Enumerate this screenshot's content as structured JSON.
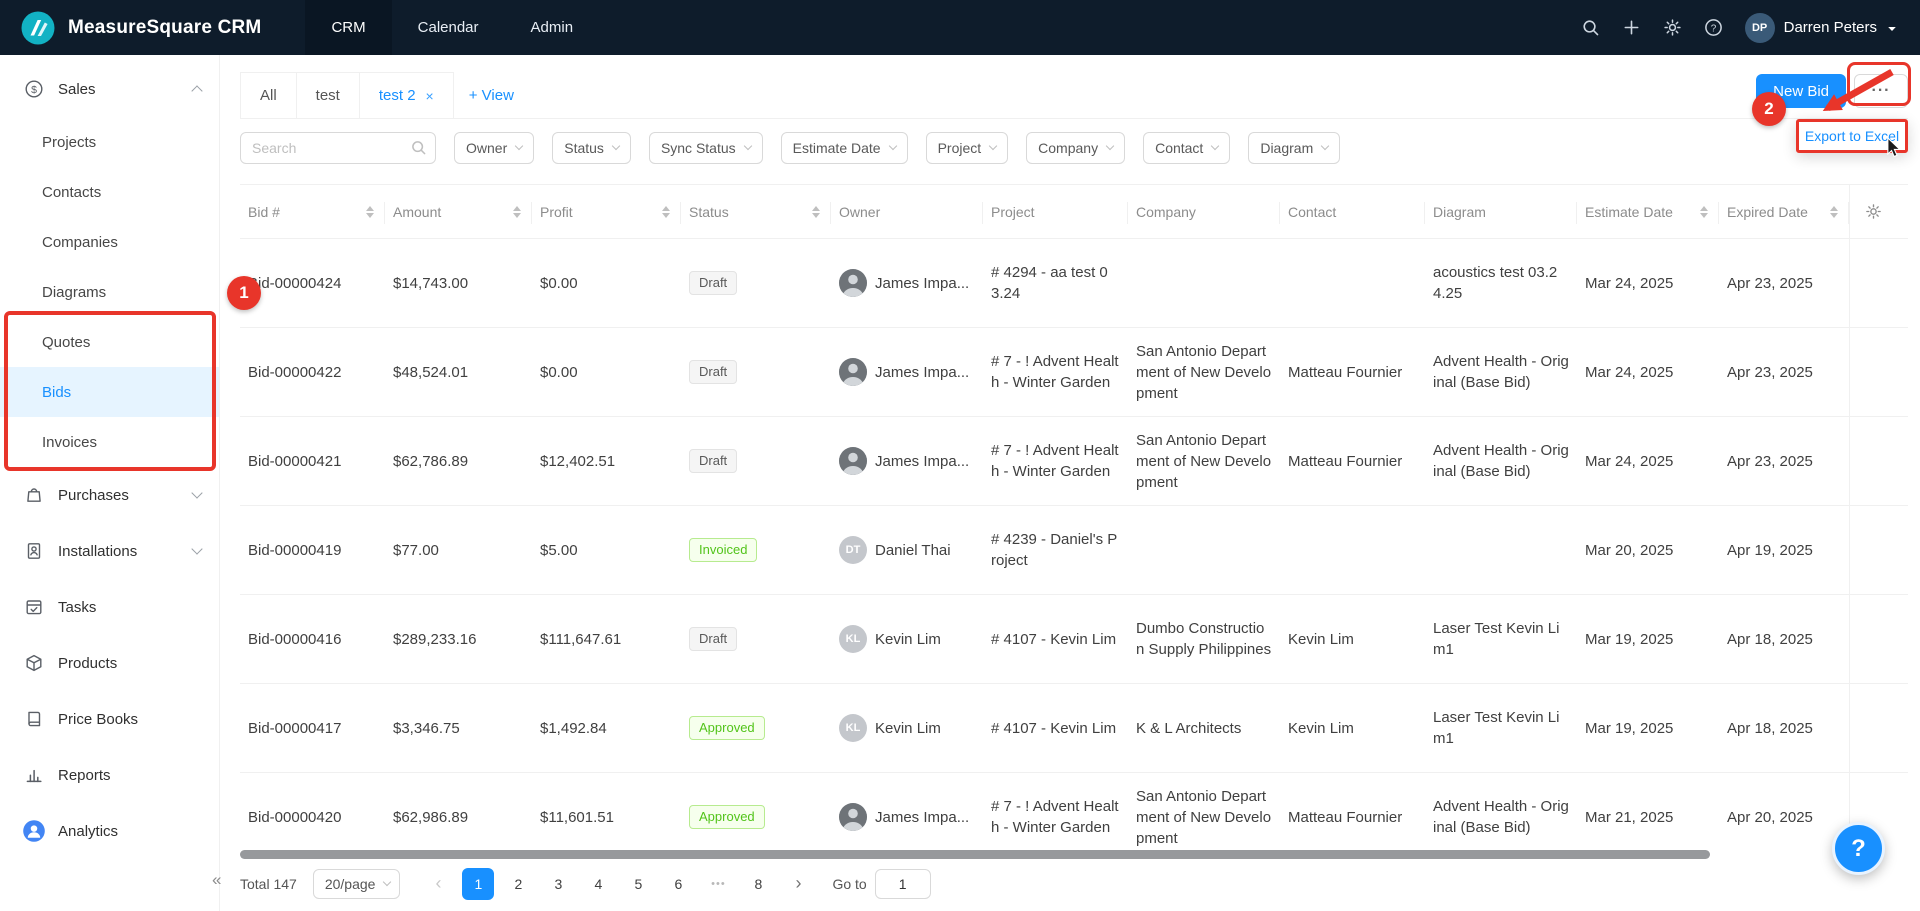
{
  "colors": {
    "accent": "#1890ff",
    "annotation_red": "#e8352a",
    "success_green": "#52c41a",
    "topbar_bg": "#0e1c2b"
  },
  "topbar": {
    "title": "MeasureSquare CRM",
    "nav": [
      {
        "label": "CRM",
        "active": true
      },
      {
        "label": "Calendar"
      },
      {
        "label": "Admin"
      }
    ],
    "user": {
      "name": "Darren Peters",
      "initials": "DP"
    }
  },
  "sidebar": {
    "items": [
      {
        "label": "Sales",
        "icon": "sales",
        "expanded": true,
        "children": [
          {
            "label": "Projects"
          },
          {
            "label": "Contacts"
          },
          {
            "label": "Companies"
          },
          {
            "label": "Diagrams"
          },
          {
            "label": "Quotes"
          },
          {
            "label": "Bids",
            "active": true
          },
          {
            "label": "Invoices"
          }
        ]
      },
      {
        "label": "Purchases",
        "icon": "purchases",
        "collapsible": true
      },
      {
        "label": "Installations",
        "icon": "installations",
        "collapsible": true
      },
      {
        "label": "Tasks",
        "icon": "tasks"
      },
      {
        "label": "Products",
        "icon": "products"
      },
      {
        "label": "Price Books",
        "icon": "price-books"
      },
      {
        "label": "Reports",
        "icon": "reports"
      },
      {
        "label": "Analytics",
        "icon": "analytics"
      }
    ],
    "collapse_icon": "«"
  },
  "tabs": {
    "items": [
      {
        "label": "All"
      },
      {
        "label": "test"
      },
      {
        "label": "test 2",
        "closable": true,
        "active": true
      }
    ],
    "close_icon": "×",
    "add_view_label": "+ View"
  },
  "toolbar": {
    "new_bid_label": "New Bid",
    "more_label": "···",
    "export_menu_item": "Export to Excel"
  },
  "filters": {
    "search_placeholder": "Search",
    "dropdowns": [
      {
        "label": "Owner"
      },
      {
        "label": "Status"
      },
      {
        "label": "Sync Status"
      },
      {
        "label": "Estimate Date"
      },
      {
        "label": "Project"
      },
      {
        "label": "Company"
      },
      {
        "label": "Contact"
      },
      {
        "label": "Diagram"
      }
    ]
  },
  "table": {
    "columns": [
      {
        "label": "Bid #",
        "sortable": true
      },
      {
        "label": "Amount",
        "sortable": true
      },
      {
        "label": "Profit",
        "sortable": true
      },
      {
        "label": "Status",
        "sortable": true
      },
      {
        "label": "Owner"
      },
      {
        "label": "Project"
      },
      {
        "label": "Company"
      },
      {
        "label": "Contact"
      },
      {
        "label": "Diagram"
      },
      {
        "label": "Estimate Date",
        "sortable": true
      },
      {
        "label": "Expired Date",
        "sortable": true
      }
    ],
    "rows": [
      {
        "bid": "Bid-00000424",
        "amount": "$14,743.00",
        "profit": "$0.00",
        "status": "Draft",
        "status_type": "default",
        "owner": "James Impa...",
        "project": "# 4294 - aa test 03.24",
        "company": "",
        "contact": "",
        "diagram": "acoustics test 03.24.25",
        "estimate_date": "Mar 24, 2025",
        "expired_date": "Apr 23, 2025"
      },
      {
        "bid": "Bid-00000422",
        "amount": "$48,524.01",
        "profit": "$0.00",
        "status": "Draft",
        "status_type": "default",
        "owner": "James Impa...",
        "project": "# 7 - ! Advent Health - Winter Garden",
        "company": "San Antonio Department of New Development",
        "contact": "Matteau Fournier",
        "diagram": "Advent Health - Original (Base Bid)",
        "estimate_date": "Mar 24, 2025",
        "expired_date": "Apr 23, 2025"
      },
      {
        "bid": "Bid-00000421",
        "amount": "$62,786.89",
        "profit": "$12,402.51",
        "status": "Draft",
        "status_type": "default",
        "owner": "James Impa...",
        "project": "# 7 - ! Advent Health - Winter Garden",
        "company": "San Antonio Department of New Development",
        "contact": "Matteau Fournier",
        "diagram": "Advent Health - Original (Base Bid)",
        "estimate_date": "Mar 24, 2025",
        "expired_date": "Apr 23, 2025"
      },
      {
        "bid": "Bid-00000419",
        "amount": "$77.00",
        "profit": "$5.00",
        "status": "Invoiced",
        "status_type": "success",
        "owner": "Daniel Thai",
        "owner_initials": "DT",
        "project": "# 4239 - Daniel's Project",
        "company": "",
        "contact": "",
        "diagram": "",
        "estimate_date": "Mar 20, 2025",
        "expired_date": "Apr 19, 2025"
      },
      {
        "bid": "Bid-00000416",
        "amount": "$289,233.16",
        "profit": "$111,647.61",
        "status": "Draft",
        "status_type": "default",
        "owner": "Kevin Lim",
        "owner_initials": "KL",
        "project": "# 4107 - Kevin Lim",
        "company": "Dumbo Construction Supply Philippines",
        "contact": "Kevin Lim",
        "diagram": "Laser Test Kevin Lim1",
        "estimate_date": "Mar 19, 2025",
        "expired_date": "Apr 18, 2025"
      },
      {
        "bid": "Bid-00000417",
        "amount": "$3,346.75",
        "profit": "$1,492.84",
        "status": "Approved",
        "status_type": "success",
        "owner": "Kevin Lim",
        "owner_initials": "KL",
        "project": "# 4107 - Kevin Lim",
        "company": "K & L Architects",
        "contact": "Kevin Lim",
        "diagram": "Laser Test Kevin Lim1",
        "estimate_date": "Mar 19, 2025",
        "expired_date": "Apr 18, 2025"
      },
      {
        "bid": "Bid-00000420",
        "amount": "$62,986.89",
        "profit": "$11,601.51",
        "status": "Approved",
        "status_type": "success",
        "owner": "James Impa...",
        "project": "# 7 - ! Advent Health - Winter Garden",
        "company": "San Antonio Department of New Development",
        "contact": "Matteau Fournier",
        "diagram": "Advent Health - Original (Base Bid)",
        "estimate_date": "Mar 21, 2025",
        "expired_date": "Apr 20, 2025"
      }
    ]
  },
  "pagination": {
    "total": "Total 147",
    "page_size": "20/page",
    "prev": "‹",
    "next": "›",
    "pages": [
      {
        "label": "1",
        "active": true
      },
      {
        "label": "2"
      },
      {
        "label": "3"
      },
      {
        "label": "4"
      },
      {
        "label": "5"
      },
      {
        "label": "6"
      },
      {
        "label": "•••",
        "type": "ellipsis"
      },
      {
        "label": "8"
      }
    ],
    "goto_label": "Go to",
    "goto_value": "1"
  },
  "annotations": {
    "step1": "1",
    "step2": "2"
  },
  "help": {
    "label": "?"
  }
}
